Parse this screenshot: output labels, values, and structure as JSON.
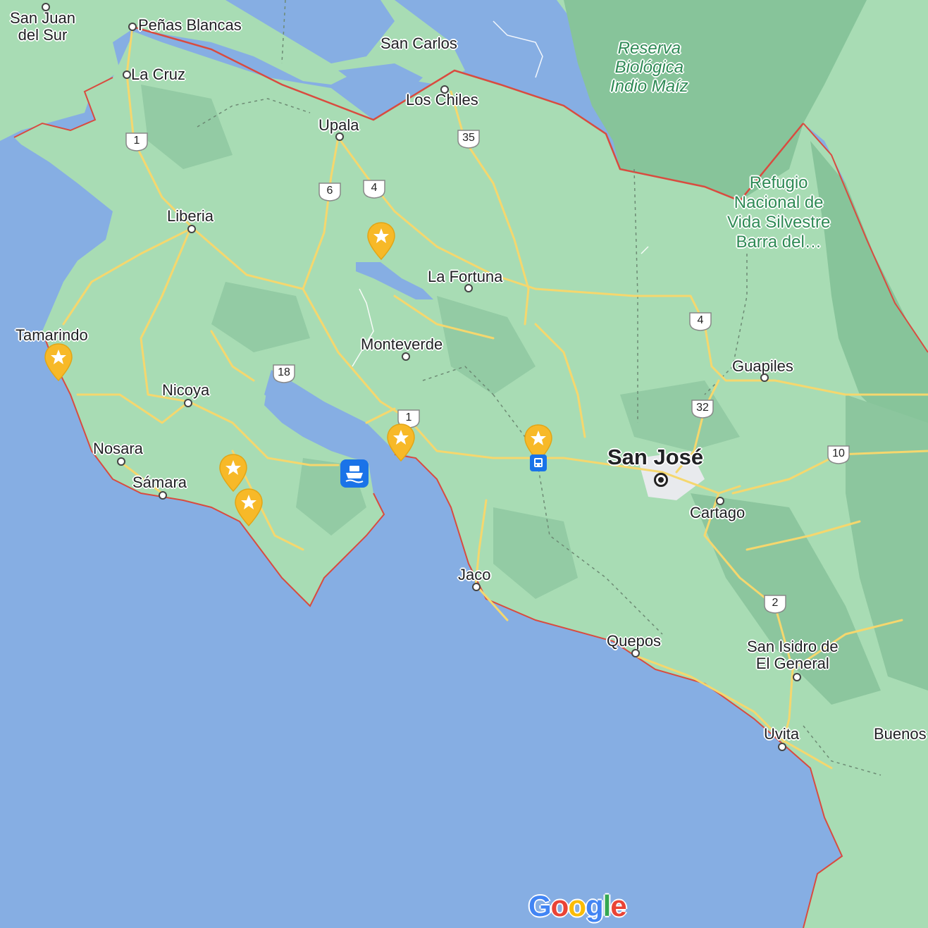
{
  "map": {
    "colors": {
      "water": "#86aee3",
      "land": "#a8dcb4",
      "forest": "#87c49a",
      "road": "#f5d76e",
      "border": "#d94b3f",
      "park_text": "#2e8a55",
      "pin": "#f7b928",
      "transit": "#1a73e8"
    },
    "labels": {
      "san_juan_del_sur": "San Juan\ndel Sur",
      "penas_blancas": "Peñas Blancas",
      "san_carlos": "San Carlos",
      "la_cruz": "La Cruz",
      "los_chiles": "Los Chiles",
      "upala": "Upala",
      "liberia": "Liberia",
      "la_fortuna": "La Fortuna",
      "tamarindo": "Tamarindo",
      "monteverde": "Monteverde",
      "nicoya": "Nicoya",
      "nosara": "Nosara",
      "samara": "Sámara",
      "guapiles": "Guapiles",
      "san_jose": "San José",
      "cartago": "Cartago",
      "jaco": "Jaco",
      "quepos": "Quepos",
      "san_isidro": "San Isidro de\nEl General",
      "uvita": "Uvita",
      "buenos": "Buenos",
      "reserva": "Reserva\nBiológica\nIndio Maíz",
      "refugio": "Refugio\nNacional de\nVida Silvestre\nBarra del…"
    },
    "routes": [
      "1",
      "35",
      "6",
      "4",
      "18",
      "1",
      "4",
      "32",
      "10",
      "2"
    ],
    "pins": [
      "starred-place",
      "starred-place",
      "starred-place",
      "starred-place",
      "starred-place",
      "starred-place"
    ],
    "ferry_icon": "ferry-icon",
    "bus_icon": "bus-station-icon",
    "logo": "Google"
  }
}
